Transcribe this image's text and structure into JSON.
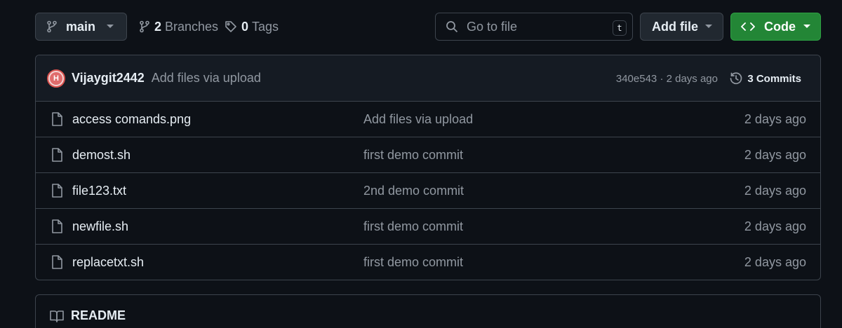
{
  "toolbar": {
    "branch_label": "main",
    "branches_count": "2",
    "branches_label": "Branches",
    "tags_count": "0",
    "tags_label": "Tags",
    "search_placeholder": "Go to file",
    "search_shortcut": "t",
    "add_file_label": "Add file",
    "code_label": "Code"
  },
  "commit": {
    "avatar_letter": "H",
    "author": "Vijaygit2442",
    "message": "Add files via upload",
    "meta": "340e543 · 2 days ago",
    "commits_label": "3 Commits"
  },
  "files": [
    {
      "name": "access comands.png",
      "message": "Add files via upload",
      "date": "2 days ago"
    },
    {
      "name": "demost.sh",
      "message": "first demo commit",
      "date": "2 days ago"
    },
    {
      "name": "file123.txt",
      "message": "2nd demo commit",
      "date": "2 days ago"
    },
    {
      "name": "newfile.sh",
      "message": "first demo commit",
      "date": "2 days ago"
    },
    {
      "name": "replacetxt.sh",
      "message": "first demo commit",
      "date": "2 days ago"
    }
  ],
  "readme": {
    "label": "README"
  },
  "colors": {
    "background": "#0d1117",
    "border": "#3d444d",
    "code_button": "#238636",
    "muted_text": "#9198a1",
    "primary_text": "#e6edf3"
  },
  "icons": {
    "branch": "git-branch-icon",
    "tag": "tag-icon",
    "search": "search-icon",
    "code": "code-icon",
    "history": "history-icon",
    "file": "file-icon",
    "book": "book-icon",
    "caret": "triangle-down-icon"
  }
}
